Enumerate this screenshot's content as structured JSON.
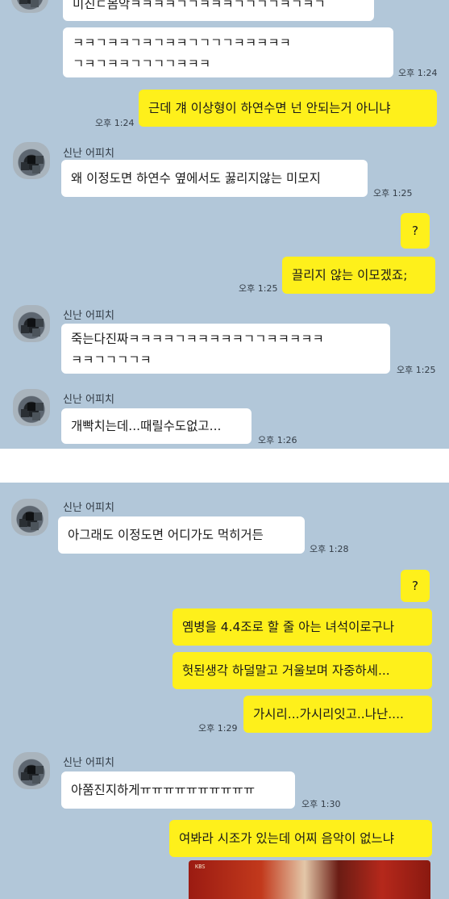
{
  "panel1": {
    "msg_partial_top": "미친ㄷ몸악ㅋㅋㅋㅋㄱㄱㅋㅋㅋㄱㄱㄱㄱㅋㄱㅋㄱ",
    "msg_laugh_line1": "ㅋㅋㄱㅋㅋㄱㅋㄱㅋㅋㄱㄱㄱㄱㅋㅋㅋㅋㅋ",
    "msg_laugh_line2": "ㄱㅋㄱㅋㅋㄱㄱㄱㄱㅋㅋㅋ",
    "time_laugh": "오후 1:24",
    "msg_out_1": "근데 걔 이상형이 하연수면 넌 안되는거 아니냐",
    "time_out_1": "오후 1:24",
    "sender_1": "신난 어피치",
    "msg_in_2": "왜 이정도면 하연수 옆에서도 꿇리지않는 미모지",
    "time_in_2": "오후 1:25",
    "msg_out_q": "?",
    "msg_out_3": "끌리지 않는 이모겠죠;",
    "time_out_3": "오후 1:25",
    "sender_2": "신난 어피치",
    "msg_in_4_line1": "죽는다진짜ㅋㅋㅋㅋㄱㅋㅋㅋㅋㅋㄱㄱㅋㅋㅋㅋㅋ",
    "msg_in_4_line2": "ㅋㅋㄱㄱㄱㄱㅋ",
    "time_in_4": "오후 1:25",
    "sender_3": "신난 어피치",
    "msg_in_5": "개빡치는데...때릴수도없고...",
    "time_in_5": "오후 1:26"
  },
  "panel2": {
    "sender_1": "신난 어피치",
    "msg_in_1": "아그래도 이정도면 어디가도 먹히거든",
    "time_in_1": "오후 1:28",
    "msg_out_q": "?",
    "msg_out_2": "옘병을 4.4조로 할 줄 아는 녀석이로구나",
    "msg_out_3": "헛된생각 하덜말고 거울보며 자중하세...",
    "msg_out_4": "가시리...가시리잇고..나난....",
    "time_out": "오후 1:29",
    "sender_2": "신난 어피치",
    "msg_in_5": "아쭘진지하게ㅠㅠㅠㅠㅠㅠㅠㅠㅠㅠ",
    "time_in_5": "오후 1:30",
    "msg_out_6": "여봐라 시조가 있는데 어찌 음악이 없느냐",
    "photo_caption": "KBS"
  },
  "colors": {
    "chat_background": "#b2c7d9",
    "bubble_out": "#fef01b",
    "bubble_in": "#ffffff"
  }
}
